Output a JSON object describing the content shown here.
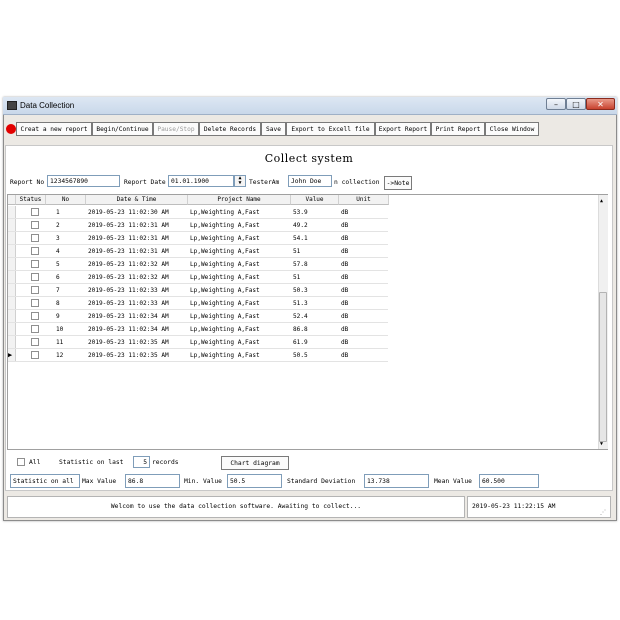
{
  "window": {
    "title": "Data Collection",
    "controls": [
      "–",
      "□",
      "✕"
    ]
  },
  "toolbar": {
    "buttons": [
      {
        "label": "Creat a new report",
        "disabled": false
      },
      {
        "label": "Begin/Continue",
        "disabled": false
      },
      {
        "label": "Pause/Stop",
        "disabled": true
      },
      {
        "label": "Delete Records",
        "disabled": false
      },
      {
        "label": "Save",
        "disabled": false
      },
      {
        "label": "Export to Excell file",
        "disabled": false
      },
      {
        "label": "Export Report",
        "disabled": false
      },
      {
        "label": "Print Report",
        "disabled": false
      },
      {
        "label": "Close Window",
        "disabled": false
      }
    ]
  },
  "form": {
    "heading": "Collect system",
    "report_no_label": "Report No",
    "report_no_value": "1234567890",
    "report_date_label": "Report Date",
    "report_date_value": "01.01.1900",
    "tester_label": "TesterAm",
    "tester_value": "John Doe",
    "collection_label": "n collection",
    "note_button": "->Note"
  },
  "table": {
    "columns": [
      "Status",
      "No",
      "Date & Time",
      "Project Name",
      "Value",
      "Unit"
    ],
    "rows": [
      {
        "no": "1",
        "datetime": "2019-05-23 11:02:30 AM",
        "project": "Lp,Weighting A,Fast",
        "value": "53.9",
        "unit": "dB"
      },
      {
        "no": "2",
        "datetime": "2019-05-23 11:02:31 AM",
        "project": "Lp,Weighting A,Fast",
        "value": "49.2",
        "unit": "dB"
      },
      {
        "no": "3",
        "datetime": "2019-05-23 11:02:31 AM",
        "project": "Lp,Weighting A,Fast",
        "value": "54.1",
        "unit": "dB"
      },
      {
        "no": "4",
        "datetime": "2019-05-23 11:02:31 AM",
        "project": "Lp,Weighting A,Fast",
        "value": "51",
        "unit": "dB"
      },
      {
        "no": "5",
        "datetime": "2019-05-23 11:02:32 AM",
        "project": "Lp,Weighting A,Fast",
        "value": "57.8",
        "unit": "dB"
      },
      {
        "no": "6",
        "datetime": "2019-05-23 11:02:32 AM",
        "project": "Lp,Weighting A,Fast",
        "value": "51",
        "unit": "dB"
      },
      {
        "no": "7",
        "datetime": "2019-05-23 11:02:33 AM",
        "project": "Lp,Weighting A,Fast",
        "value": "50.3",
        "unit": "dB"
      },
      {
        "no": "8",
        "datetime": "2019-05-23 11:02:33 AM",
        "project": "Lp,Weighting A,Fast",
        "value": "51.3",
        "unit": "dB"
      },
      {
        "no": "9",
        "datetime": "2019-05-23 11:02:34 AM",
        "project": "Lp,Weighting A,Fast",
        "value": "52.4",
        "unit": "dB"
      },
      {
        "no": "10",
        "datetime": "2019-05-23 11:02:34 AM",
        "project": "Lp,Weighting A,Fast",
        "value": "86.8",
        "unit": "dB"
      },
      {
        "no": "11",
        "datetime": "2019-05-23 11:02:35 AM",
        "project": "Lp,Weighting A,Fast",
        "value": "61.9",
        "unit": "dB"
      },
      {
        "no": "12",
        "datetime": "2019-05-23 11:02:35 AM",
        "project": "Lp,Weighting A,Fast",
        "value": "50.5",
        "unit": "dB"
      }
    ]
  },
  "stats": {
    "all_label": "All",
    "statistic_on_last_label": "Statistic on last",
    "last_count": "5",
    "records_label": "records",
    "chart_button": "Chart diagram",
    "statistic_on_all": "Statistic on all",
    "max_label": "Max  Value",
    "max_value": "86.8",
    "min_label": "Min. Value",
    "min_value": "50.5",
    "std_label": "Standard Deviation",
    "std_value": "13.738",
    "mean_label": "Mean Value",
    "mean_value": "60.500"
  },
  "statusbar": {
    "message": "Welcom to use the data collection software. Awaiting to collect...",
    "timestamp": "2019-05-23 11:22:15 AM"
  }
}
